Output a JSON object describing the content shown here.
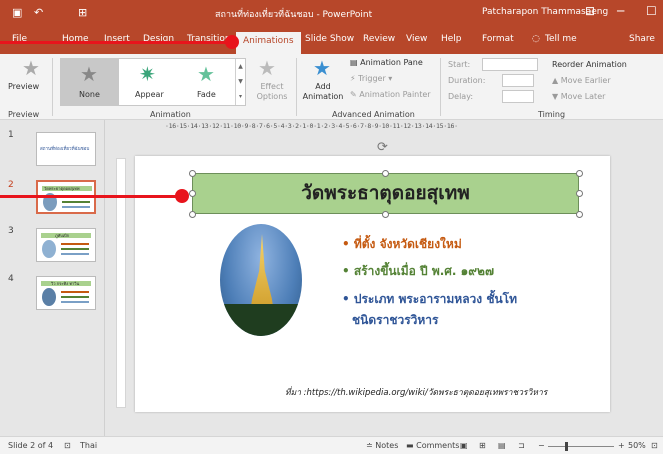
{
  "titlebar": {
    "doc_title": "สถานที่ท่องเที่ยวที่ฉันชอบ - PowerPoint",
    "user": "Patcharapon Thammasaeng"
  },
  "tabs": [
    "File",
    "Home",
    "Insert",
    "Design",
    "Transitions",
    "Animations",
    "Slide Show",
    "Review",
    "View",
    "Help",
    "Format",
    "Tell me",
    "Share"
  ],
  "ribbon": {
    "preview_label": "Preview",
    "preview_group": "Preview",
    "gallery": [
      "None",
      "Appear",
      "Fade"
    ],
    "effect_options": "Effect Options",
    "animation_group": "Animation",
    "add_animation": "Add Animation",
    "animation_pane": "Animation Pane",
    "trigger": "Trigger",
    "animation_painter": "Animation Painter",
    "advanced_group": "Advanced Animation",
    "start": "Start:",
    "duration": "Duration:",
    "delay": "Delay:",
    "reorder": "Reorder Animation",
    "move_earlier": "Move Earlier",
    "move_later": "Move Later",
    "timing_group": "Timing"
  },
  "ruler_h": "·16·15·14·13·12·11·10·9·8·7·6·5·4·3·2·1·0·1·2·3·4·5·6·7·8·9·10·11·12·13·14·15·16·",
  "thumbnails": [
    {
      "num": "1",
      "text": "สถานที่ท่องเที่ยวที่ฉันชอบ"
    },
    {
      "num": "2",
      "text": "วัดพระธาตุดอยสุเทพ"
    },
    {
      "num": "3",
      "text": "ภูทับเบิก"
    },
    {
      "num": "4",
      "text": "วิว กระทิง ทาวิน"
    }
  ],
  "slide": {
    "title": "วัดพระธาตุดอยสุเทพ",
    "bullets": [
      "• ที่ตั้ง  จังหวัดเชียงใหม่",
      "• สร้างขึ้นเมื่อ ปี พ.ศ. ๑๙๒๗",
      "• ประเภท พระอารามหลวง ชั้นโท",
      "ชนิดราชวรวิหาร"
    ],
    "caption": "ที่มา :https://th.wikipedia.org/wiki/วัดพระธาตุดอยสุเทพราชวรวิหาร"
  },
  "status": {
    "slide": "Slide 2 of 4",
    "language": "Thai",
    "notes": "Notes",
    "comments": "Comments",
    "zoom": "50%"
  },
  "colors": {
    "accent": "#b7472a",
    "title_fill": "#a9d18e",
    "bullet1": "#c55a11",
    "bullet2": "#548235",
    "bullet3": "#2f5597",
    "callout": "#e8141c"
  }
}
